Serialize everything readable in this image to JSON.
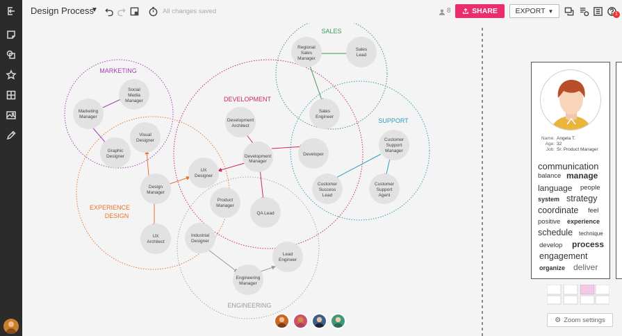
{
  "header": {
    "title": "Design Process",
    "save_status": "All changes saved",
    "collaborator_count": "8",
    "share_label": "SHARE",
    "export_label": "EXPORT",
    "notification_count": "1"
  },
  "rail": {
    "icons": [
      "exit-icon",
      "sticky-note-icon",
      "shapes-icon",
      "star-icon",
      "table-icon",
      "image-icon",
      "pencil-icon"
    ]
  },
  "diagram": {
    "groups": [
      {
        "label": "MARKETING",
        "color": "#a63fb7"
      },
      {
        "label": "SALES",
        "color": "#3c9a58"
      },
      {
        "label": "DEVELOPMENT",
        "color": "#d0265a"
      },
      {
        "label": "SUPPORT",
        "color": "#2b9fbe"
      },
      {
        "label": "EXPERIENCE",
        "label2": "DESIGN",
        "color": "#e8742c"
      },
      {
        "label": "ENGINEERING",
        "color": "#999999"
      }
    ],
    "nodes": [
      {
        "id": "marketing-manager",
        "lines": [
          "Marketing",
          "Manager"
        ]
      },
      {
        "id": "social-media-manager",
        "lines": [
          "Social",
          "Media",
          "Manager"
        ]
      },
      {
        "id": "graphic-designer",
        "lines": [
          "Graphic",
          "Designer"
        ]
      },
      {
        "id": "visual-designer",
        "lines": [
          "Visual",
          "Designer"
        ]
      },
      {
        "id": "design-manager",
        "lines": [
          "Design",
          "Manager"
        ]
      },
      {
        "id": "ux-architect",
        "lines": [
          "UX",
          "Architect"
        ]
      },
      {
        "id": "ux-designer",
        "lines": [
          "UX",
          "Designer"
        ]
      },
      {
        "id": "development-architect",
        "lines": [
          "Development",
          "Architect"
        ]
      },
      {
        "id": "development-manager",
        "lines": [
          "Development",
          "Manager"
        ]
      },
      {
        "id": "developer",
        "lines": [
          "Developer"
        ]
      },
      {
        "id": "product-manager",
        "lines": [
          "Product",
          "Manager"
        ]
      },
      {
        "id": "qa-lead",
        "lines": [
          "QA Lead"
        ]
      },
      {
        "id": "regional-sales-manager",
        "lines": [
          "Regional",
          "Sales",
          "Manager"
        ]
      },
      {
        "id": "sales-lead",
        "lines": [
          "Sales",
          "Lead"
        ]
      },
      {
        "id": "sales-engineer",
        "lines": [
          "Sales",
          "Engineer"
        ]
      },
      {
        "id": "customer-support-manager",
        "lines": [
          "Customer",
          "Support",
          "Manager"
        ]
      },
      {
        "id": "customer-success-lead",
        "lines": [
          "Customer",
          "Success",
          "Lead"
        ]
      },
      {
        "id": "customer-support-agent",
        "lines": [
          "Customer",
          "Support",
          "Agent"
        ]
      },
      {
        "id": "industrial-designer",
        "lines": [
          "Industrial",
          "Designer"
        ]
      },
      {
        "id": "lead-engineer",
        "lines": [
          "Lead",
          "Engineer"
        ]
      },
      {
        "id": "engineering-manager",
        "lines": [
          "Engineering",
          "Manager"
        ]
      }
    ]
  },
  "profile": {
    "name_label": "Name:",
    "name": "Angela T.",
    "age_label": "Age:",
    "age": "32",
    "job_label": "Job:",
    "job": "Sr. Product Manager",
    "words": [
      "communication",
      "balance",
      "manage",
      "language",
      "people",
      "system",
      "strategy",
      "coordinate",
      "feel",
      "positive",
      "experience",
      "schedule",
      "technique",
      "develop",
      "process",
      "engagement",
      "organize",
      "deliver"
    ]
  },
  "zoom_settings_label": "Zoom settings",
  "collaborators": [
    "collaborator-1",
    "collaborator-2",
    "collaborator-3",
    "collaborator-4"
  ]
}
